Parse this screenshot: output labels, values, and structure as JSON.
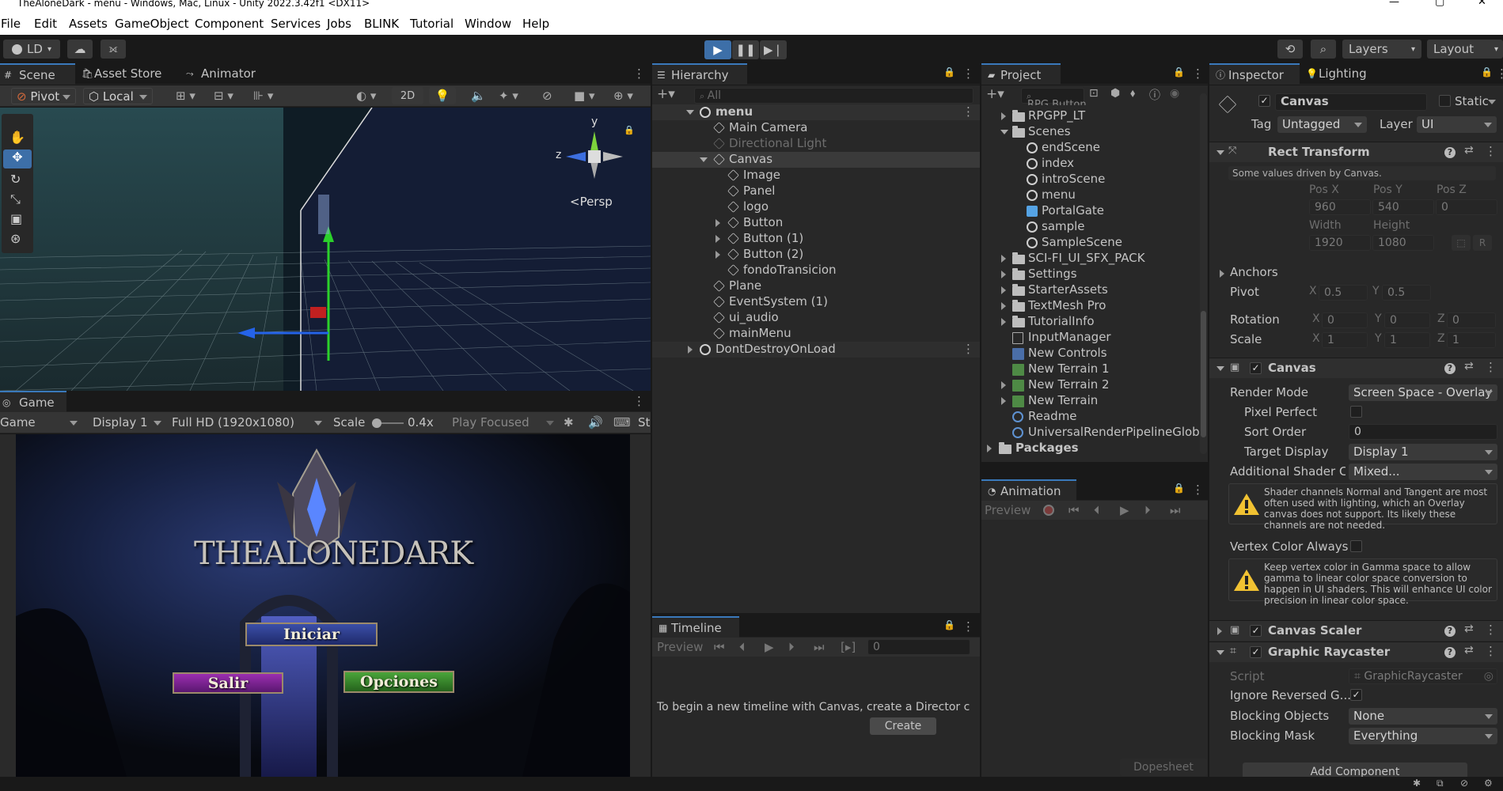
{
  "window": {
    "title": "TheAloneDark - menu - Windows, Mac, Linux - Unity 2022.3.42f1 <DX11>",
    "minimize": "—",
    "maximize": "▢",
    "close": "✕"
  },
  "menu": [
    "File",
    "Edit",
    "Assets",
    "GameObject",
    "Component",
    "Services",
    "Jobs",
    "BLINK",
    "Tutorial",
    "Window",
    "Help"
  ],
  "toolbar": {
    "account": "LD",
    "layers": "Layers",
    "layout": "Layout"
  },
  "scene": {
    "tabs": [
      "Scene",
      "Asset Store",
      "Animator"
    ],
    "pivot": "Pivot",
    "local": "Local",
    "mode2d": "2D",
    "gizmo": {
      "persp": "<Persp",
      "y": "y",
      "z": "z"
    }
  },
  "game": {
    "tab": "Game",
    "view": "Game",
    "display": "Display 1",
    "resolution": "Full HD (1920x1080)",
    "scale_label": "Scale",
    "scale_value": "0.4x",
    "play_focused": "Play Focused",
    "stats": "St",
    "title_text": "THEALONEDARK",
    "buttons": {
      "start": "Iniciar",
      "exit": "Salir",
      "options": "Opciones"
    }
  },
  "hierarchy": {
    "tab": "Hierarchy",
    "search_placeholder": "All",
    "scene": "menu",
    "items": [
      "Main Camera",
      "Directional Light",
      "Canvas",
      "Image",
      "Panel",
      "logo",
      "Button",
      "Button (1)",
      "Button (2)",
      "fondoTransicion",
      "Plane",
      "EventSystem (1)",
      "ui_audio",
      "mainMenu"
    ],
    "dontdestroy": "DontDestroyOnLoad"
  },
  "timeline": {
    "tab": "Timeline",
    "preview": "Preview",
    "frame": "0",
    "message": "To begin a new timeline with Canvas, create a Director c",
    "create": "Create"
  },
  "project": {
    "tab": "Project",
    "items": [
      "RPGPP_LT",
      "Scenes",
      "endScene",
      "index",
      "introScene",
      "menu",
      "PortalGate",
      "sample",
      "SampleScene",
      "SCI-FI_UI_SFX_PACK",
      "Settings",
      "StarterAssets",
      "TextMesh Pro",
      "TutorialInfo",
      "InputManager",
      "New Controls",
      "New Terrain 1",
      "New Terrain 2",
      "New Terrain",
      "Readme",
      "UniversalRenderPipelineGlob",
      "Packages"
    ],
    "partial_top": "RPG Button"
  },
  "animation": {
    "tab": "Animation",
    "preview": "Preview",
    "dopesheet": "Dopesheet"
  },
  "inspector": {
    "tabs": [
      "Inspector",
      "Lighting"
    ],
    "object_name": "Canvas",
    "static": "Static",
    "tag_label": "Tag",
    "tag": "Untagged",
    "layer_label": "Layer",
    "layer": "UI",
    "rect": {
      "title": "Rect Transform",
      "note": "Some values driven by Canvas.",
      "posx_l": "Pos X",
      "posy_l": "Pos Y",
      "posz_l": "Pos Z",
      "posx": "960",
      "posy": "540",
      "posz": "0",
      "width_l": "Width",
      "height_l": "Height",
      "width": "1920",
      "height": "1080",
      "r": "R",
      "anchors": "Anchors",
      "pivot_l": "Pivot",
      "pivot_x": "0.5",
      "pivot_y": "0.5",
      "rotation_l": "Rotation",
      "rot_x": "0",
      "rot_y": "0",
      "rot_z": "0",
      "scale_l": "Scale",
      "scale_x": "1",
      "scale_y": "1",
      "scale_z": "1",
      "X": "X",
      "Y": "Y",
      "Z": "Z"
    },
    "canvas": {
      "title": "Canvas",
      "render_mode_l": "Render Mode",
      "render_mode": "Screen Space - Overlay",
      "pixel_perfect_l": "Pixel Perfect",
      "sort_order_l": "Sort Order",
      "sort_order": "0",
      "target_display_l": "Target Display",
      "target_display": "Display 1",
      "shader_ch_l": "Additional Shader Ch",
      "shader_ch": "Mixed...",
      "warn1": "Shader channels Normal and Tangent are most often used with lighting, which an Overlay canvas does not support. Its likely these channels are not needed.",
      "vertex_color_l": "Vertex Color Always",
      "warn2": "Keep vertex color in Gamma space to allow gamma to linear color space conversion to happen in UI shaders. This will enhance UI color precision in linear color space."
    },
    "scaler": {
      "title": "Canvas Scaler"
    },
    "raycaster": {
      "title": "Graphic Raycaster",
      "script_l": "Script",
      "script": "GraphicRaycaster",
      "ignore_l": "Ignore Reversed G...",
      "blocking_objects_l": "Blocking Objects",
      "blocking_objects": "None",
      "blocking_mask_l": "Blocking Mask",
      "blocking_mask": "Everything"
    },
    "add_component": "Add Component"
  }
}
